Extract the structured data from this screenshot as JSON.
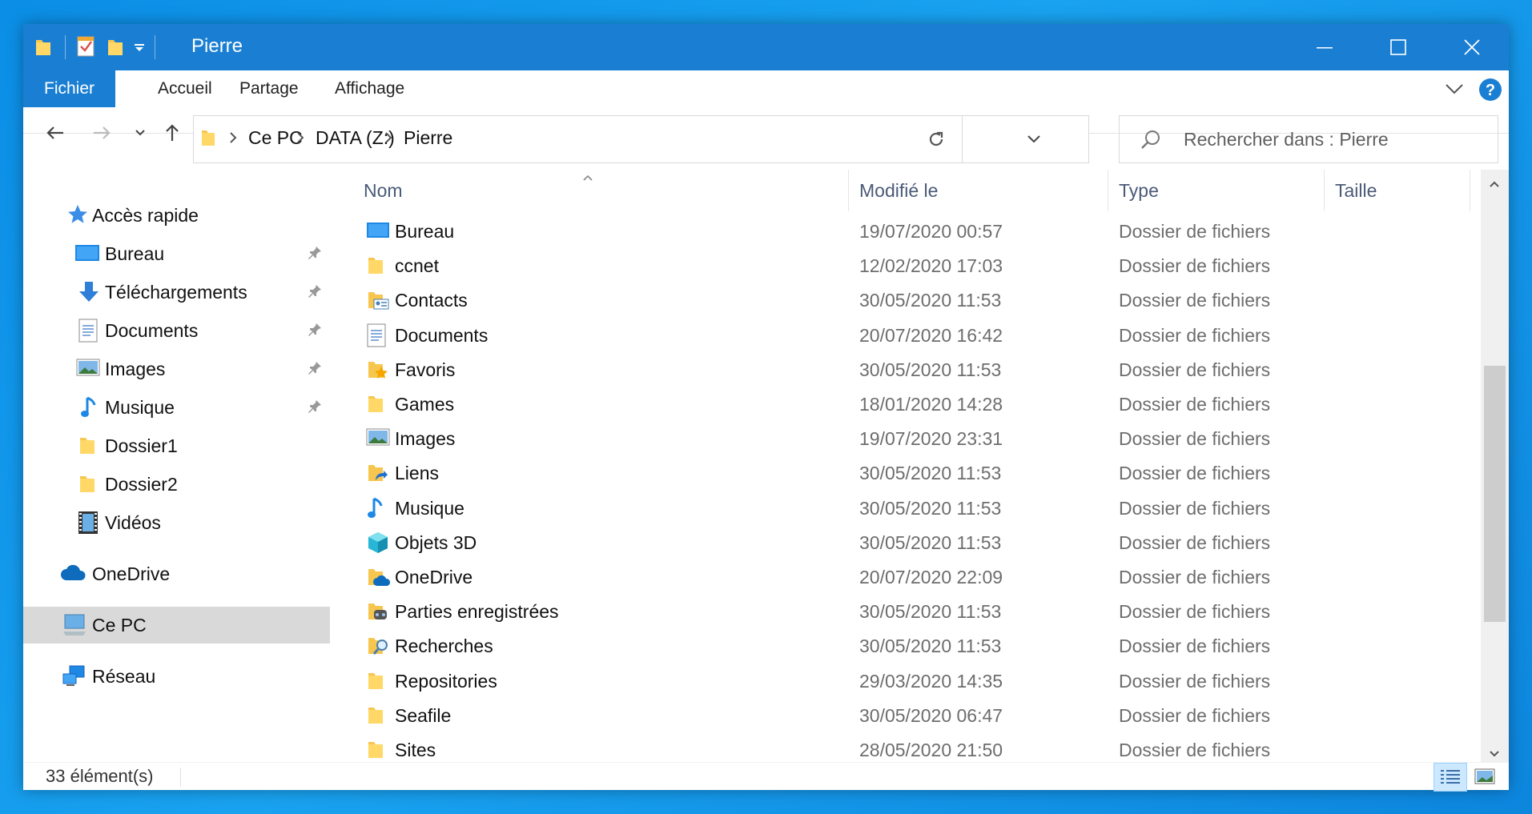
{
  "window": {
    "title": "Pierre"
  },
  "ribbon": {
    "tabs": [
      "Fichier",
      "Accueil",
      "Partage",
      "Affichage"
    ]
  },
  "address": {
    "crumbs": [
      "Ce PC",
      "DATA (Z:)",
      "Pierre"
    ],
    "search_placeholder": "Rechercher dans : Pierre"
  },
  "nav": {
    "quick_access": "Accès rapide",
    "pinned": [
      "Bureau",
      "Téléchargements",
      "Documents",
      "Images",
      "Musique"
    ],
    "unpinned": [
      "Dossier1",
      "Dossier2",
      "Vidéos"
    ],
    "onedrive": "OneDrive",
    "this_pc": "Ce PC",
    "network": "Réseau"
  },
  "columns": [
    "Nom",
    "Modifié le",
    "Type",
    "Taille"
  ],
  "files": [
    {
      "name": "Bureau",
      "date": "19/07/2020 00:57",
      "type": "Dossier de fichiers",
      "icon": "desktop-icon"
    },
    {
      "name": "ccnet",
      "date": "12/02/2020 17:03",
      "type": "Dossier de fichiers",
      "icon": "folder-icon"
    },
    {
      "name": "Contacts",
      "date": "30/05/2020 11:53",
      "type": "Dossier de fichiers",
      "icon": "contacts-folder-icon"
    },
    {
      "name": "Documents",
      "date": "20/07/2020 16:42",
      "type": "Dossier de fichiers",
      "icon": "documents-icon"
    },
    {
      "name": "Favoris",
      "date": "30/05/2020 11:53",
      "type": "Dossier de fichiers",
      "icon": "favorites-folder-icon"
    },
    {
      "name": "Games",
      "date": "18/01/2020 14:28",
      "type": "Dossier de fichiers",
      "icon": "folder-icon"
    },
    {
      "name": "Images",
      "date": "19/07/2020 23:31",
      "type": "Dossier de fichiers",
      "icon": "pictures-icon"
    },
    {
      "name": "Liens",
      "date": "30/05/2020 11:53",
      "type": "Dossier de fichiers",
      "icon": "links-folder-icon"
    },
    {
      "name": "Musique",
      "date": "30/05/2020 11:53",
      "type": "Dossier de fichiers",
      "icon": "music-icon"
    },
    {
      "name": "Objets 3D",
      "date": "30/05/2020 11:53",
      "type": "Dossier de fichiers",
      "icon": "3d-objects-icon"
    },
    {
      "name": "OneDrive",
      "date": "20/07/2020 22:09",
      "type": "Dossier de fichiers",
      "icon": "onedrive-folder-icon"
    },
    {
      "name": "Parties enregistrées",
      "date": "30/05/2020 11:53",
      "type": "Dossier de fichiers",
      "icon": "saved-games-icon"
    },
    {
      "name": "Recherches",
      "date": "30/05/2020 11:53",
      "type": "Dossier de fichiers",
      "icon": "searches-folder-icon"
    },
    {
      "name": "Repositories",
      "date": "29/03/2020 14:35",
      "type": "Dossier de fichiers",
      "icon": "folder-icon"
    },
    {
      "name": "Seafile",
      "date": "30/05/2020 06:47",
      "type": "Dossier de fichiers",
      "icon": "folder-icon"
    },
    {
      "name": "Sites",
      "date": "28/05/2020 21:50",
      "type": "Dossier de fichiers",
      "icon": "folder-icon"
    }
  ],
  "status": {
    "count": "33 élément(s)"
  },
  "colors": {
    "accent": "#1a7fd3",
    "folder": "#f6c64f",
    "selection": "#d9d9d9"
  }
}
